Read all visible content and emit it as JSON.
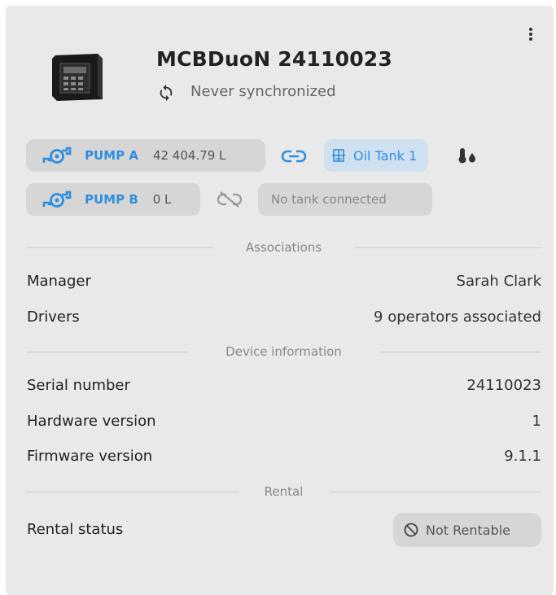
{
  "device": {
    "title": "MCBDuoN 24110023",
    "sync_status": "Never synchronized"
  },
  "pumps": [
    {
      "label": "PUMP A",
      "value": "42 404.79 L",
      "link": "linked",
      "tank": "Oil Tank 1"
    },
    {
      "label": "PUMP B",
      "value": "0 L",
      "link": "unlinked",
      "tank": "No tank connected"
    }
  ],
  "sections": {
    "associations": "Associations",
    "device_information": "Device information",
    "rental": "Rental"
  },
  "associations": {
    "manager_label": "Manager",
    "manager_value": "Sarah Clark",
    "drivers_label": "Drivers",
    "drivers_value": "9 operators associated"
  },
  "device_information": {
    "serial_label": "Serial number",
    "serial_value": "24110023",
    "hardware_label": "Hardware version",
    "hardware_value": "1",
    "firmware_label": "Firmware version",
    "firmware_value": "9.1.1"
  },
  "rental": {
    "status_label": "Rental status",
    "status_value": "Not Rentable"
  },
  "colors": {
    "card_bg": "#e9e9e9",
    "chip_bg": "#d6d6d6",
    "accent_blue": "#2f8ee0",
    "tank_chip_bg": "#cfe1f1"
  },
  "icons": [
    "device-image",
    "sync-icon",
    "pump-icon",
    "link-icon",
    "unlink-icon",
    "tank-icon",
    "temperature-drop-icon",
    "ban-icon",
    "more-vert-icon"
  ]
}
